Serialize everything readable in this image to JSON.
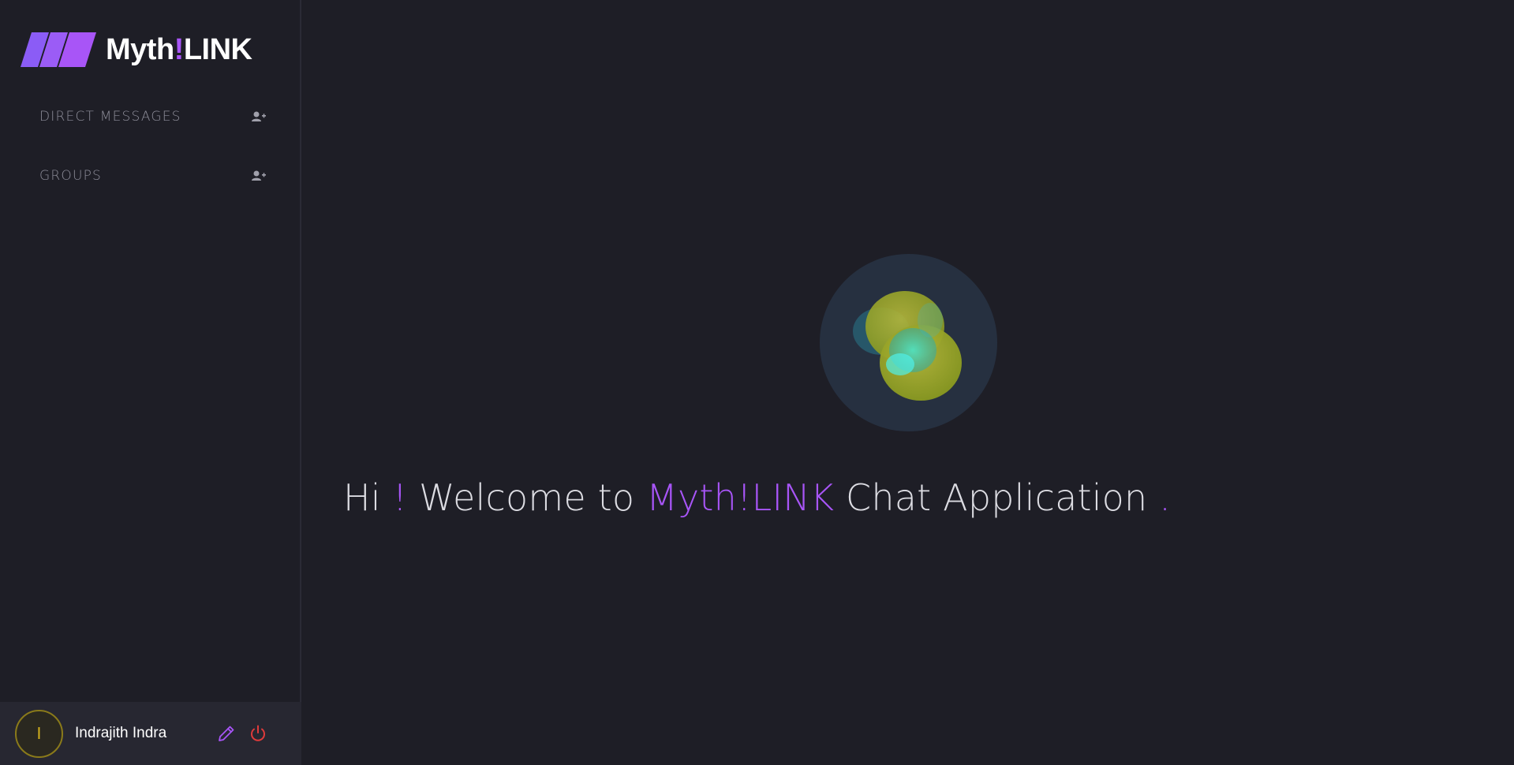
{
  "brand": {
    "name_part1": "Myth",
    "name_bang": "!",
    "name_part2": "LINK",
    "accent_color": "#a855f7"
  },
  "sidebar": {
    "sections": [
      {
        "label": "DIRECT MESSAGES",
        "action_icon": "add-user-icon"
      },
      {
        "label": "GROUPS",
        "action_icon": "add-user-icon"
      }
    ]
  },
  "user": {
    "avatar_initial": "I",
    "name": "Indrajith Indra",
    "edit_icon": "pencil-icon",
    "logout_icon": "power-icon",
    "logout_color": "#e03b3b"
  },
  "welcome": {
    "part1": "Hi ",
    "bang": "!",
    "part2": " Welcome to ",
    "app_name": "Myth!LINK",
    "part3": " Chat Application ",
    "dot": "."
  }
}
